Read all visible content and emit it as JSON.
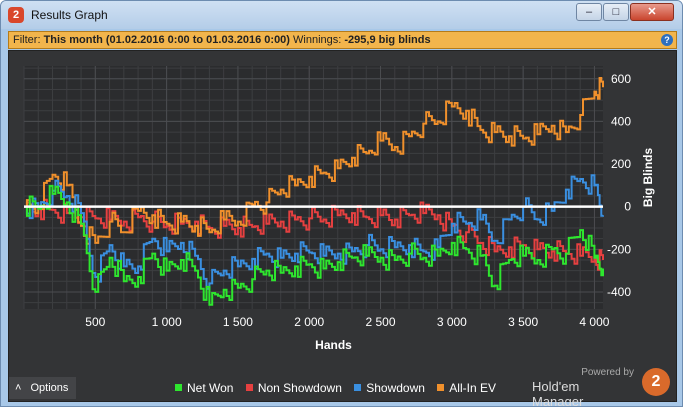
{
  "window": {
    "title": "Results Graph",
    "app_icon_glyph": "2",
    "buttons": {
      "minimize": "–",
      "maximize": "□",
      "close": "✕"
    }
  },
  "filter": {
    "label": "Filter:",
    "period": "This month (01.02.2016 0:00 to 01.03.2016 0:00)",
    "winnings_label": "Winnings:",
    "winnings_value": "-295,9 big blinds",
    "help_glyph": "?"
  },
  "options": {
    "label": "Options",
    "glyph": "˄"
  },
  "branding": {
    "powered_by": "Powered by",
    "name": "Hold'em Manager",
    "logo_glyph": "2"
  },
  "colors": {
    "background": "#333436",
    "net_won": "#2ee62e",
    "non_showdown": "#e64040",
    "showdown": "#3a8fe0",
    "all_in_ev": "#f0902c",
    "zero_line": "#ffffff"
  },
  "chart_data": {
    "type": "line",
    "xlabel": "Hands",
    "ylabel": "Big Blinds",
    "xlim": [
      0,
      4060
    ],
    "ylim": [
      -480,
      660
    ],
    "x_ticks": [
      500,
      1000,
      1500,
      2000,
      2500,
      3000,
      3500,
      4000
    ],
    "x_tick_labels": [
      "500",
      "1 000",
      "1 500",
      "2 000",
      "2 500",
      "3 000",
      "3 500",
      "4 000"
    ],
    "y_ticks": [
      600,
      400,
      200,
      0,
      -200,
      -400
    ],
    "y_tick_labels": [
      "600",
      "400",
      "200",
      "0",
      "-200",
      "-400"
    ],
    "y_axis_side": "right",
    "grid": true,
    "legend_position": "bottom",
    "x": [
      0,
      100,
      200,
      300,
      400,
      500,
      600,
      700,
      800,
      900,
      1000,
      1100,
      1200,
      1300,
      1400,
      1500,
      1600,
      1700,
      1800,
      1900,
      2000,
      2100,
      2200,
      2300,
      2400,
      2500,
      2600,
      2700,
      2800,
      2900,
      3000,
      3100,
      3200,
      3300,
      3400,
      3500,
      3600,
      3700,
      3800,
      3900,
      4000,
      4060
    ],
    "series": [
      {
        "name": "Net Won",
        "color_key": "net_won",
        "values": [
          0,
          -10,
          60,
          20,
          -80,
          -400,
          -240,
          -350,
          -330,
          -220,
          -300,
          -250,
          -300,
          -460,
          -390,
          -380,
          -340,
          -300,
          -310,
          -280,
          -270,
          -290,
          -260,
          -240,
          -230,
          -240,
          -250,
          -220,
          -240,
          -230,
          -170,
          -200,
          -230,
          -370,
          -250,
          -230,
          -250,
          -200,
          -220,
          -110,
          -240,
          -290
        ]
      },
      {
        "name": "Non Showdown",
        "color_key": "non_showdown",
        "values": [
          0,
          -5,
          -15,
          -30,
          -50,
          -55,
          -60,
          -70,
          -50,
          -70,
          -90,
          -80,
          -70,
          -100,
          -90,
          -100,
          -95,
          -80,
          -70,
          -60,
          -55,
          -60,
          -40,
          -30,
          -50,
          -40,
          -60,
          -40,
          -30,
          -40,
          -90,
          -120,
          -170,
          -210,
          -190,
          -180,
          -200,
          -210,
          -220,
          -230,
          -240,
          -250
        ]
      },
      {
        "name": "Showdown",
        "color_key": "showdown",
        "values": [
          0,
          -5,
          75,
          50,
          -30,
          -330,
          -180,
          -280,
          -280,
          -150,
          -210,
          -170,
          -230,
          -360,
          -300,
          -280,
          -245,
          -220,
          -240,
          -220,
          -215,
          -230,
          -220,
          -210,
          -180,
          -200,
          -190,
          -180,
          -210,
          -190,
          -80,
          -80,
          -60,
          -160,
          -60,
          0,
          -60,
          -20,
          80,
          130,
          100,
          -40
        ]
      },
      {
        "name": "All-In EV",
        "color_key": "all_in_ev",
        "values": [
          0,
          0,
          150,
          100,
          -90,
          -170,
          -70,
          -120,
          -20,
          -40,
          -80,
          -70,
          -90,
          -120,
          -60,
          -70,
          10,
          20,
          80,
          100,
          140,
          160,
          180,
          230,
          250,
          310,
          280,
          330,
          390,
          400,
          470,
          450,
          360,
          350,
          330,
          320,
          340,
          380,
          350,
          430,
          540,
          560
        ]
      }
    ]
  },
  "legend": [
    {
      "label": "Net Won",
      "color_key": "net_won"
    },
    {
      "label": "Non Showdown",
      "color_key": "non_showdown"
    },
    {
      "label": "Showdown",
      "color_key": "showdown"
    },
    {
      "label": "All-In EV",
      "color_key": "all_in_ev"
    }
  ]
}
